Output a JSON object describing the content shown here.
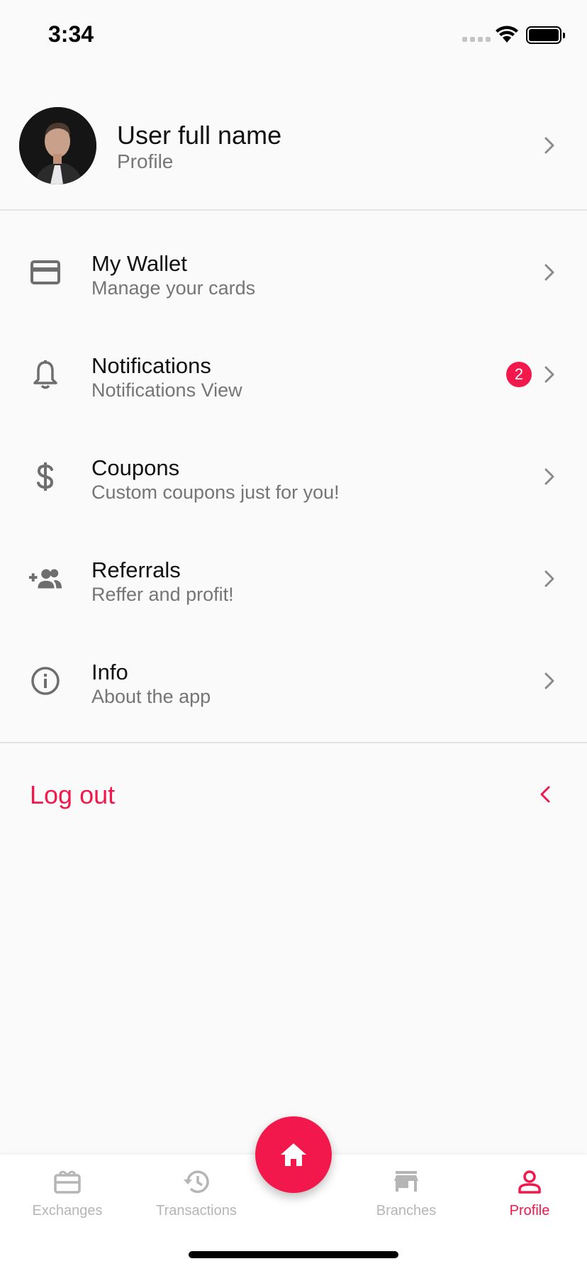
{
  "status_bar": {
    "time": "3:34"
  },
  "profile": {
    "name": "User full name",
    "subtitle": "Profile"
  },
  "menu": {
    "items": [
      {
        "title": "My Wallet",
        "subtitle": "Manage your cards",
        "icon": "credit-card-icon"
      },
      {
        "title": "Notifications",
        "subtitle": "Notifications View",
        "icon": "bell-icon",
        "badge": "2"
      },
      {
        "title": "Coupons",
        "subtitle": "Custom coupons just for you!",
        "icon": "dollar-icon"
      },
      {
        "title": "Referrals",
        "subtitle": "Reffer and profit!",
        "icon": "add-people-icon"
      },
      {
        "title": "Info",
        "subtitle": "About the app",
        "icon": "info-icon"
      }
    ]
  },
  "logout": {
    "label": "Log out"
  },
  "bottom_nav": {
    "items": [
      {
        "label": "Exchanges",
        "icon": "gift-card-icon"
      },
      {
        "label": "Transactions",
        "icon": "history-icon"
      },
      {
        "label": "Branches",
        "icon": "store-icon"
      },
      {
        "label": "Profile",
        "icon": "person-icon",
        "active": true
      }
    ],
    "fab_icon": "home-icon"
  },
  "colors": {
    "accent": "#f2184b",
    "background": "#fafafa",
    "icon_gray": "#6e6e6e",
    "inactive_nav": "#b5b5b5"
  }
}
